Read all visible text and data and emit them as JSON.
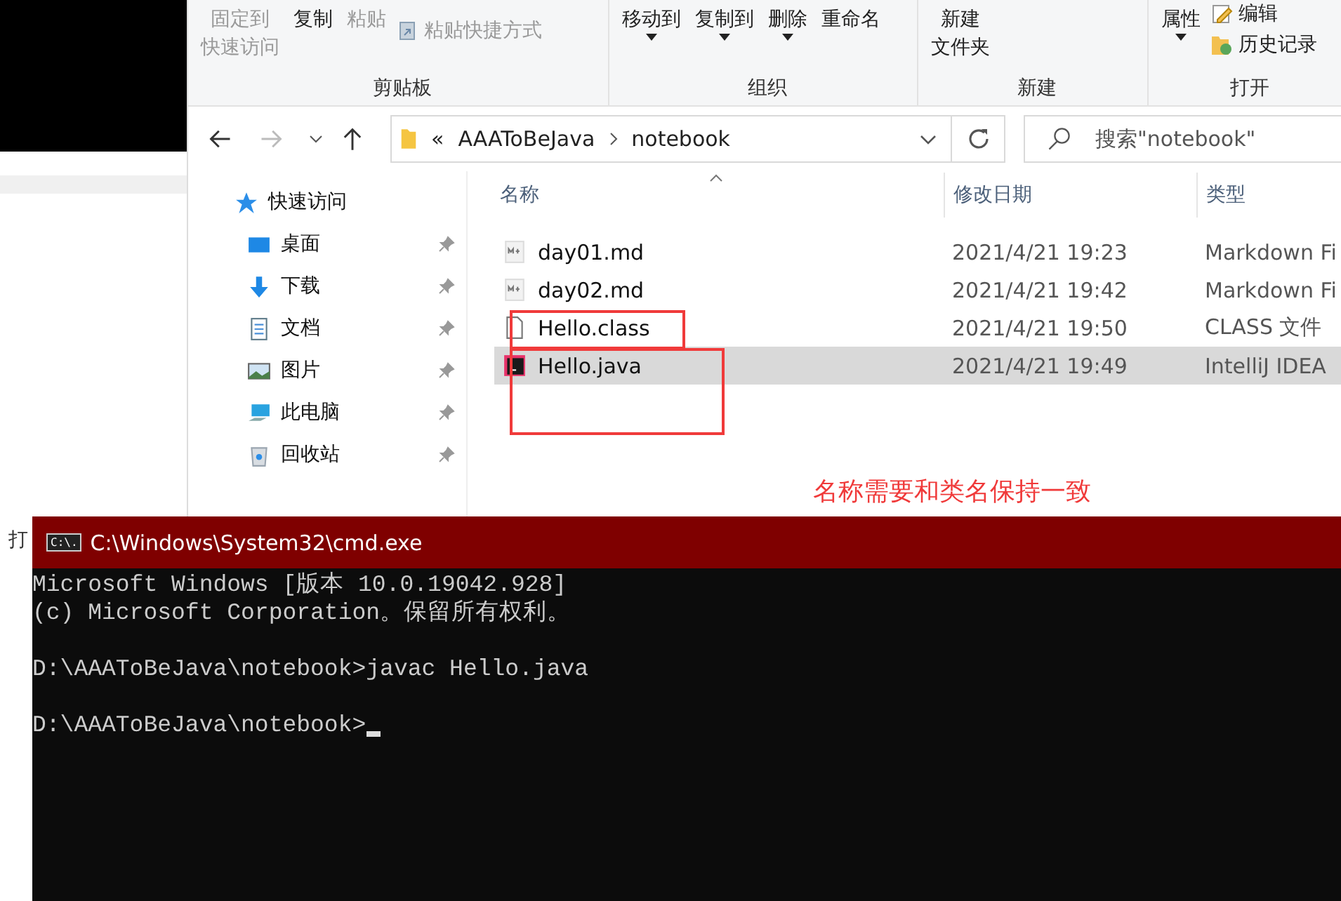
{
  "background": {
    "side_text": "打"
  },
  "explorer": {
    "ribbon": {
      "groups": [
        {
          "label": "剪贴板",
          "items": [
            {
              "kind": "large",
              "label": [
                "固定到",
                "快速访问"
              ],
              "disabled": true,
              "dropdown": false
            },
            {
              "kind": "large",
              "label": [
                "复制"
              ],
              "disabled": false,
              "dropdown": false
            },
            {
              "kind": "large",
              "label": [
                "粘贴"
              ],
              "disabled": true,
              "dropdown": false
            },
            {
              "kind": "shortcut",
              "label": "粘贴快捷方式",
              "disabled": true
            }
          ]
        },
        {
          "label": "组织",
          "items": [
            {
              "kind": "large",
              "label": [
                "移动到"
              ],
              "disabled": false,
              "dropdown": true
            },
            {
              "kind": "large",
              "label": [
                "复制到"
              ],
              "disabled": false,
              "dropdown": true
            },
            {
              "kind": "large",
              "label": [
                "删除"
              ],
              "disabled": false,
              "dropdown": true
            },
            {
              "kind": "large",
              "label": [
                "重命名"
              ],
              "disabled": false,
              "dropdown": false
            }
          ]
        },
        {
          "label": "新建",
          "items": [
            {
              "kind": "large",
              "label": [
                "新建",
                "文件夹"
              ],
              "disabled": false,
              "dropdown": false
            }
          ]
        },
        {
          "label": "打开",
          "items": [
            {
              "kind": "large",
              "label": [
                "属性"
              ],
              "disabled": false,
              "dropdown": true
            },
            {
              "kind": "edit",
              "label": "编辑",
              "disabled": false
            },
            {
              "kind": "history",
              "label": "历史记录",
              "disabled": false
            }
          ]
        }
      ]
    },
    "address": {
      "overflow": "«",
      "path": [
        "AAAToBeJava",
        "notebook"
      ]
    },
    "search": {
      "placeholder": "搜索\"notebook\""
    },
    "nav_pane": {
      "header": "快速访问",
      "items": [
        {
          "label": "桌面",
          "kind": "desktop"
        },
        {
          "label": "下载",
          "kind": "download"
        },
        {
          "label": "文档",
          "kind": "documents"
        },
        {
          "label": "图片",
          "kind": "pictures"
        },
        {
          "label": "此电脑",
          "kind": "computer"
        },
        {
          "label": "回收站",
          "kind": "recycle"
        }
      ]
    },
    "table": {
      "columns": [
        "名称",
        "修改日期",
        "类型"
      ],
      "rows": [
        {
          "name": "day01.md",
          "date": "2021/4/21 19:23",
          "type": "Markdown Fi",
          "kind": "markdown",
          "selected": false
        },
        {
          "name": "day02.md",
          "date": "2021/4/21 19:42",
          "type": "Markdown Fi",
          "kind": "markdown",
          "selected": false
        },
        {
          "name": "Hello.class",
          "date": "2021/4/21 19:50",
          "type": "CLASS 文件",
          "kind": "file",
          "selected": false
        },
        {
          "name": "Hello.java",
          "date": "2021/4/21 19:49",
          "type": "IntelliJ IDEA",
          "kind": "java",
          "selected": true
        }
      ]
    },
    "annotation": "名称需要和类名保持一致"
  },
  "cmd": {
    "title": "C:\\Windows\\System32\\cmd.exe",
    "icon_text": "C:\\.",
    "blocks": [
      [
        "Microsoft Windows [版本 10.0.19042.928]",
        "(c) Microsoft Corporation。保留所有权利。"
      ],
      [
        "D:\\AAAToBeJava\\notebook>javac Hello.java"
      ],
      [
        "D:\\AAAToBeJava\\notebook>"
      ]
    ],
    "cursor": true
  }
}
